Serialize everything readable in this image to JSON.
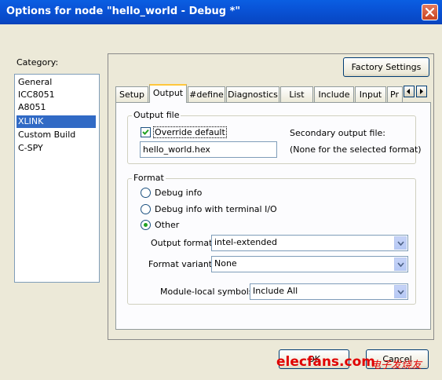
{
  "window": {
    "title": "Options for node \"hello_world - Debug *\""
  },
  "category": {
    "label": "Category:",
    "items": [
      "General",
      "ICC8051",
      "A8051",
      "XLINK",
      "Custom Build",
      "C-SPY"
    ],
    "selected": "XLINK"
  },
  "factory_settings_label": "Factory Settings",
  "tabs": [
    "Setup",
    "Output",
    "#define",
    "Diagnostics",
    "List",
    "Include",
    "Input",
    "Pr"
  ],
  "active_tab": "Output",
  "output_file": {
    "group_title": "Output file",
    "override_label": "Override default",
    "override_checked": true,
    "filename": "hello_world.hex",
    "secondary_label": "Secondary output file:",
    "secondary_value": "(None for the selected format)"
  },
  "format": {
    "group_title": "Format",
    "options": [
      "Debug info",
      "Debug info with terminal I/O",
      "Other"
    ],
    "selected": "Other",
    "output_format_label": "Output format:",
    "output_format_value": "intel-extended",
    "format_variant_label": "Format variant:",
    "format_variant_value": "None",
    "module_local_label": "Module-local symbols:",
    "module_local_value": "Include All"
  },
  "buttons": {
    "ok": "OK",
    "cancel": "Cancel"
  },
  "watermark": {
    "site": "elecfans.com",
    "cn": "电子发烧友"
  }
}
